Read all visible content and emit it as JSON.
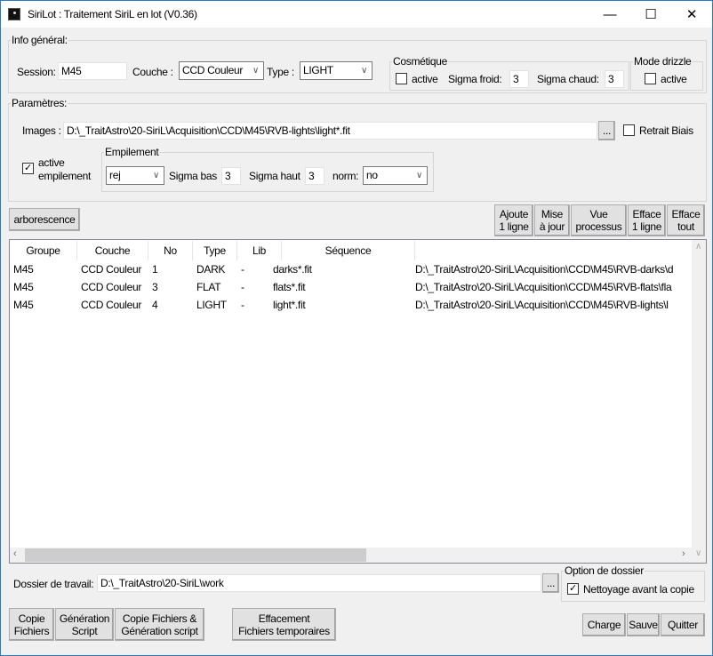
{
  "window": {
    "title": "SiriLot : Traitement SiriL en lot (V0.36)",
    "minimize": "—",
    "maximize": "☐",
    "close": "✕"
  },
  "info": {
    "legend": "Info général:",
    "session_label": "Session:",
    "session_value": "M45",
    "couche_label": "Couche :",
    "couche_value": "CCD Couleur",
    "type_label": "Type :",
    "type_value": "LIGHT"
  },
  "cosmetique": {
    "legend": "Cosmétique",
    "active_label": "active",
    "active_checked": false,
    "sigma_froid_label": "Sigma froid:",
    "sigma_froid": "3",
    "sigma_chaud_label": "Sigma chaud:",
    "sigma_chaud": "3"
  },
  "drizzle": {
    "legend": "Mode drizzle",
    "active_label": "active",
    "active_checked": false
  },
  "params": {
    "legend": "Paramètres:",
    "images_label": "Images :",
    "images_value": "D:\\_TraitAstro\\20-SiriL\\Acquisition\\CCD\\M45\\RVB-lights\\light*.fit",
    "browse": "...",
    "retrait_label": "Retrait Biais",
    "retrait_checked": false,
    "active_emp_line1": "active",
    "active_emp_line2": "empilement",
    "active_emp_checked": true
  },
  "empilement": {
    "legend": "Empilement",
    "method": "rej",
    "sigma_bas_label": "Sigma bas",
    "sigma_bas": "3",
    "sigma_haut_label": "Sigma haut",
    "sigma_haut": "3",
    "norm_label": "norm:",
    "norm": "no"
  },
  "toolbar": {
    "arborescence": "arborescence",
    "ajoute": [
      "Ajoute",
      "1 ligne"
    ],
    "mise": [
      "Mise",
      "à jour"
    ],
    "vue": [
      "Vue",
      "processus"
    ],
    "efface1": [
      "Efface",
      "1 ligne"
    ],
    "effacetout": [
      "Efface",
      "tout"
    ]
  },
  "table": {
    "headers": [
      "Groupe",
      "Couche",
      "No",
      "Type",
      "Lib",
      "Séquence"
    ],
    "rows": [
      [
        "M45",
        "CCD Couleur",
        "1",
        "DARK",
        "-",
        "darks*.fit",
        "D:\\_TraitAstro\\20-SiriL\\Acquisition\\CCD\\M45\\RVB-darks\\d"
      ],
      [
        "M45",
        "CCD Couleur",
        "3",
        "FLAT",
        "-",
        "flats*.fit",
        "D:\\_TraitAstro\\20-SiriL\\Acquisition\\CCD\\M45\\RVB-flats\\fla"
      ],
      [
        "M45",
        "CCD Couleur",
        "4",
        "LIGHT",
        "-",
        "light*.fit",
        "D:\\_TraitAstro\\20-SiriL\\Acquisition\\CCD\\M45\\RVB-lights\\l"
      ]
    ],
    "scroll_position_fraction": 0
  },
  "dossier": {
    "label": "Dossier de travail:",
    "value": "D:\\_TraitAstro\\20-SiriL\\work",
    "browse": "...",
    "option_legend": "Option de dossier",
    "nettoyage_label": "Nettoyage avant la copie",
    "nettoyage_checked": true
  },
  "bottom": {
    "copie": [
      "Copie",
      "Fichiers"
    ],
    "generation": [
      "Génération",
      "Script"
    ],
    "copiegen": [
      "Copie Fichiers &",
      "Génération script"
    ],
    "effacement": [
      "Effacement",
      "Fichiers temporaires"
    ],
    "charge": "Charge",
    "sauve": "Sauve",
    "quitter": "Quitter"
  }
}
